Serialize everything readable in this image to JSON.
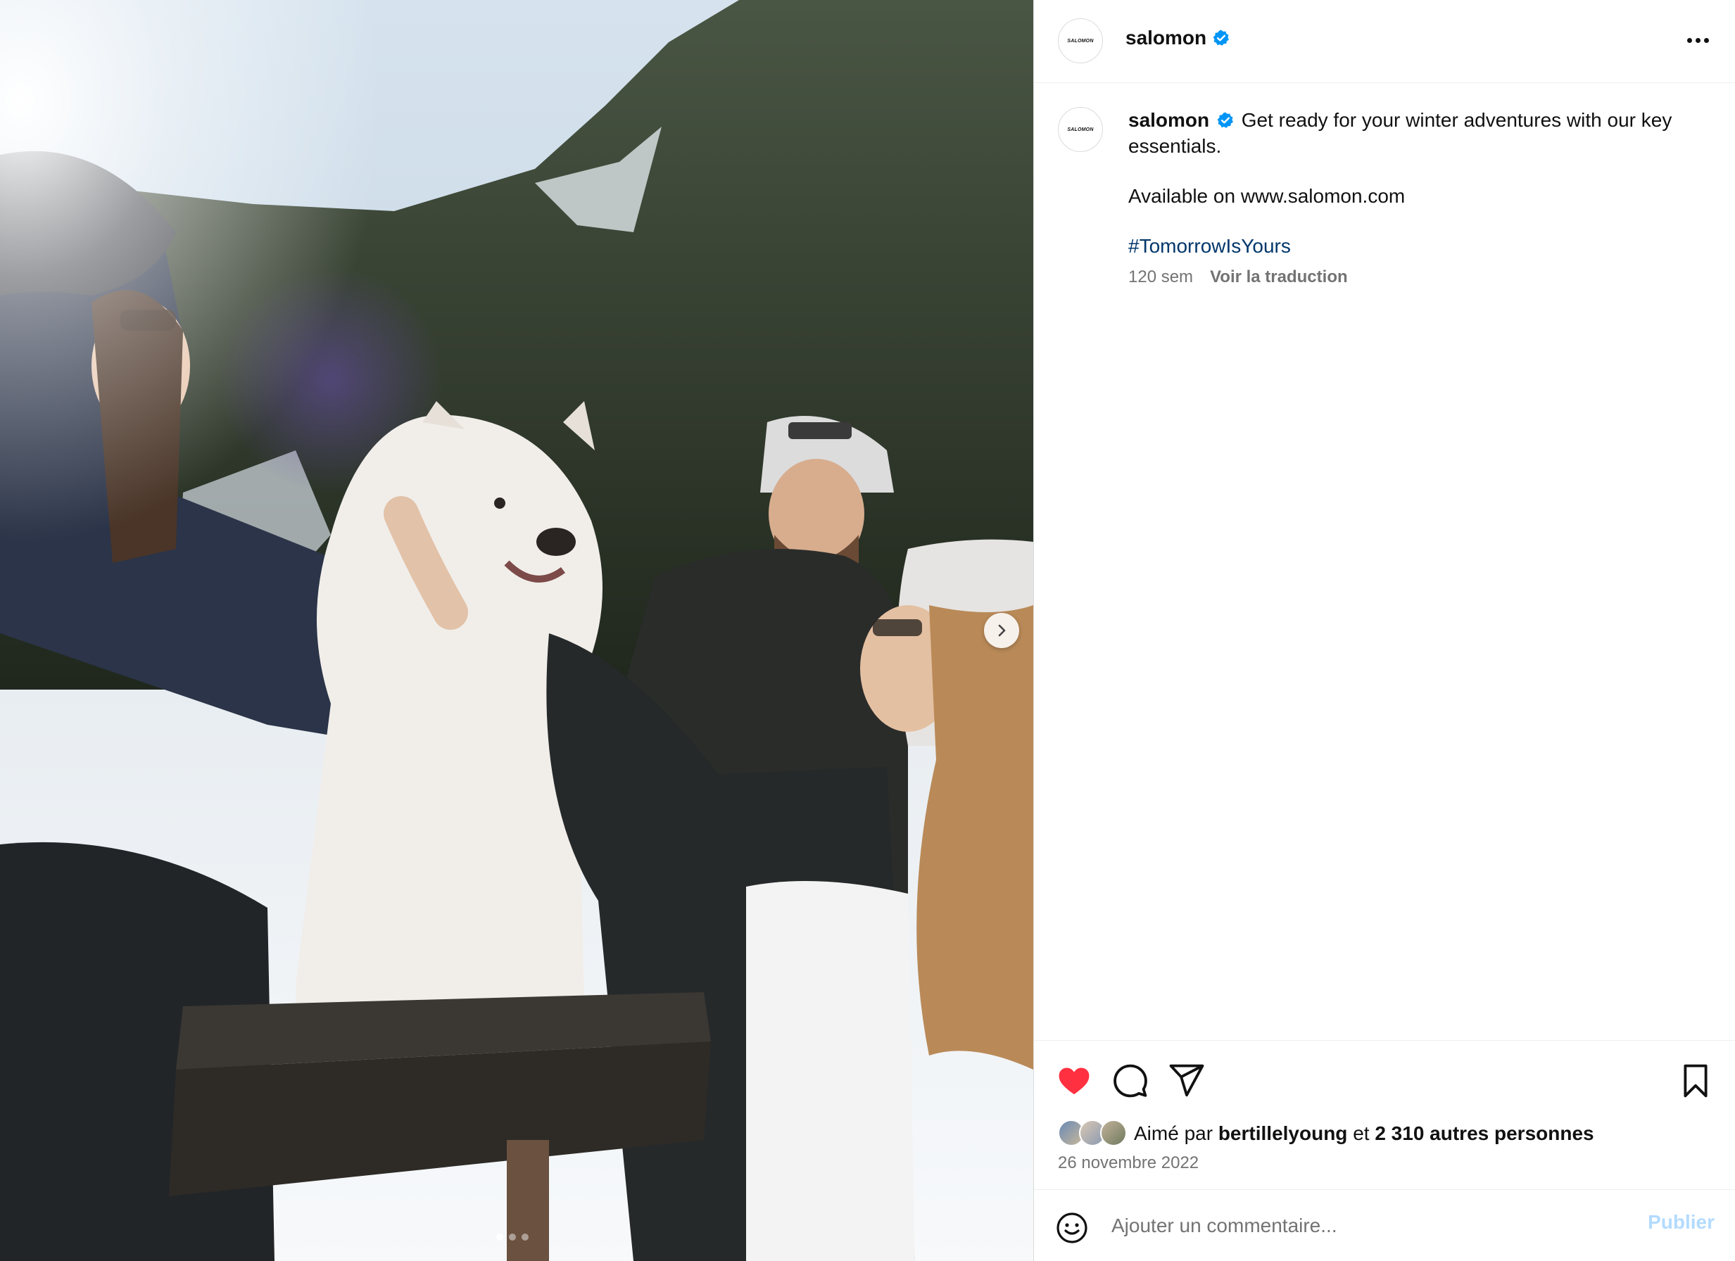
{
  "header": {
    "username": "salomon",
    "avatar_text": "SALOMON",
    "more_icon": "more-horizontal-icon"
  },
  "caption": {
    "username": "salomon",
    "text": "Get ready for your winter adventures with our key essentials.",
    "line2": "Available on www.salomon.com",
    "hashtag": "#TomorrowIsYours",
    "age": "120 sem",
    "translate": "Voir la traduction"
  },
  "actions": {
    "liked": true,
    "like_color": "#ff3040"
  },
  "likes": {
    "prefix": "Aimé par",
    "user": "bertillelyoung",
    "joiner": "et",
    "count_text": "2 310 autres personnes"
  },
  "date": "26 novembre 2022",
  "comment": {
    "placeholder": "Ajouter un commentaire...",
    "publish": "Publier"
  },
  "carousel": {
    "slides": 3,
    "current": 1
  },
  "colors": {
    "verified": "#0095f6",
    "link": "#00376b",
    "muted": "#737373",
    "publish_disabled": "#b3dbff"
  }
}
